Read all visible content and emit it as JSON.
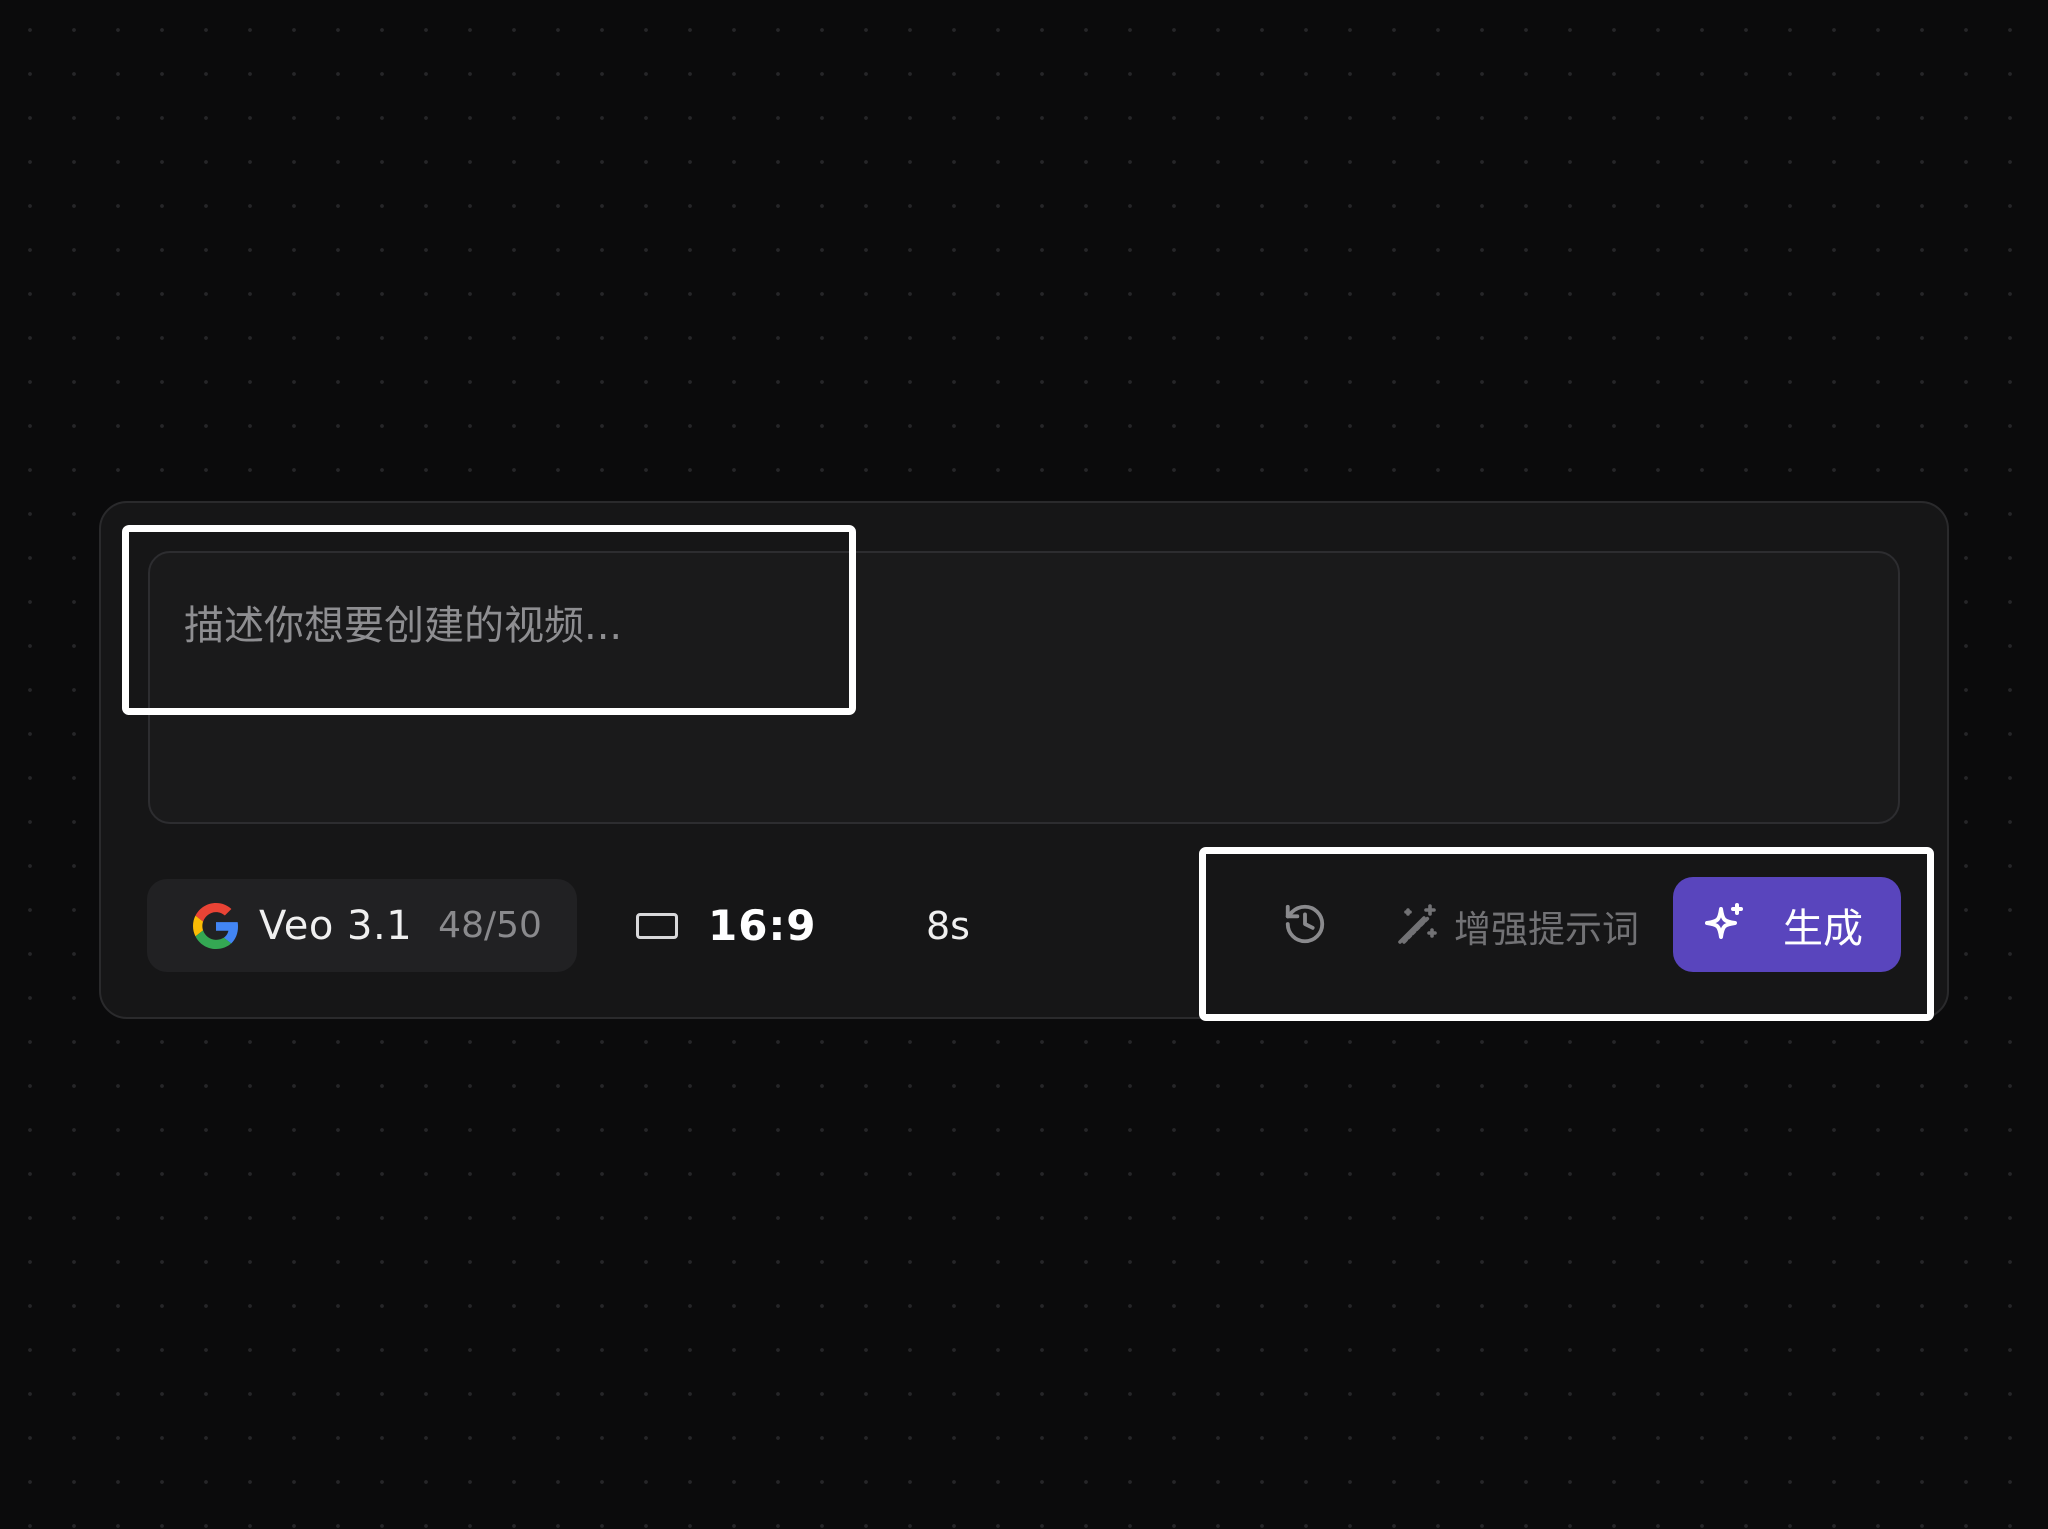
{
  "prompt": {
    "placeholder": "描述你想要创建的视频..."
  },
  "model": {
    "provider_icon": "google-icon",
    "name": "Veo 3.1",
    "quota": "48/50"
  },
  "aspect_ratio": {
    "icon": "aspect-ratio-icon",
    "label": "16:9"
  },
  "duration": {
    "label": "8s"
  },
  "actions": {
    "history_icon": "history-icon",
    "enhance_icon": "magic-wand-icon",
    "enhance_label": "增强提示词",
    "generate_icon": "sparkle-icon",
    "generate_label": "生成"
  },
  "colors": {
    "accent": "#5945bd",
    "panel_bg": "#161617",
    "page_bg": "#0b0b0c",
    "highlight_border": "#ffffff"
  }
}
